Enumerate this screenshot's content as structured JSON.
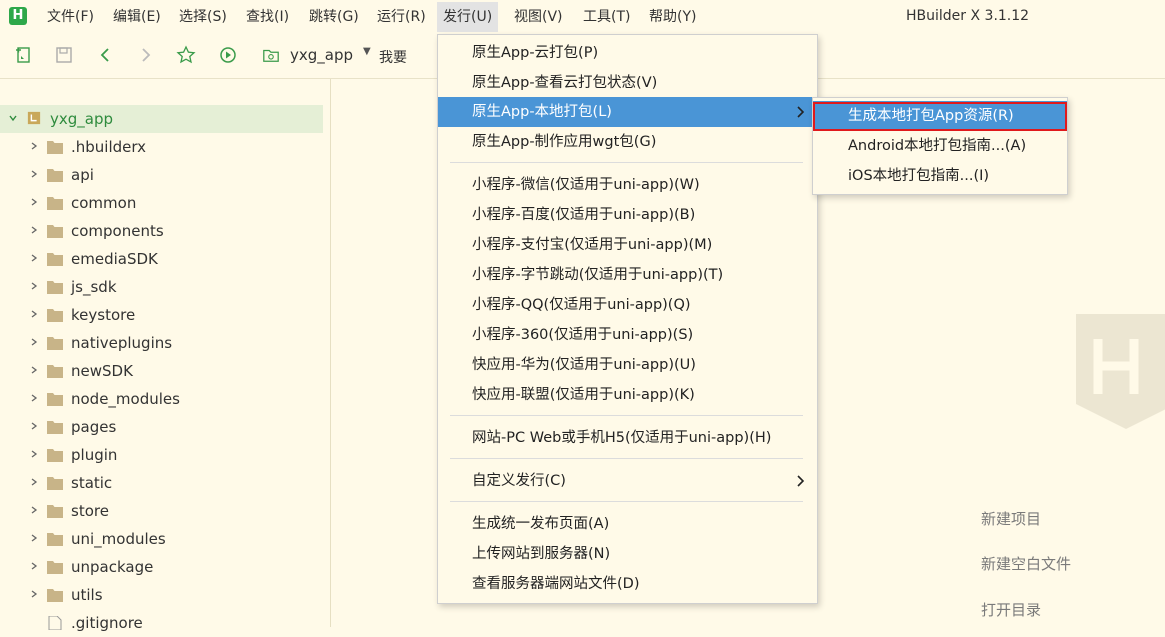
{
  "menubar": {
    "items": [
      "文件(F)",
      "编辑(E)",
      "选择(S)",
      "查找(I)",
      "跳转(G)",
      "运行(R)",
      "发行(U)",
      "视图(V)",
      "工具(T)",
      "帮助(Y)"
    ],
    "app_title": "HBuilder X 3.1.12",
    "logo": "H"
  },
  "toolbar": {
    "project_tab": "yxg_app",
    "search_text": "我要"
  },
  "sidebar": {
    "root": "yxg_app",
    "items": [
      ".hbuilderx",
      "api",
      "common",
      "components",
      "emediaSDK",
      "js_sdk",
      "keystore",
      "nativeplugins",
      "newSDK",
      "node_modules",
      "pages",
      "plugin",
      "static",
      "store",
      "uni_modules",
      "unpackage",
      "utils",
      ".gitignore"
    ]
  },
  "welcome": {
    "links": [
      "新建项目",
      "新建空白文件",
      "打开目录"
    ]
  },
  "publish_menu": {
    "items": [
      "原生App-云打包(P)",
      "原生App-查看云打包状态(V)",
      "原生App-本地打包(L)",
      "原生App-制作应用wgt包(G)",
      "小程序-微信(仅适用于uni-app)(W)",
      "小程序-百度(仅适用于uni-app)(B)",
      "小程序-支付宝(仅适用于uni-app)(M)",
      "小程序-字节跳动(仅适用于uni-app)(T)",
      "小程序-QQ(仅适用于uni-app)(Q)",
      "小程序-360(仅适用于uni-app)(S)",
      "快应用-华为(仅适用于uni-app)(U)",
      "快应用-联盟(仅适用于uni-app)(K)",
      "网站-PC Web或手机H5(仅适用于uni-app)(H)",
      "自定义发行(C)",
      "生成统一发布页面(A)",
      "上传网站到服务器(N)",
      "查看服务器端网站文件(D)"
    ]
  },
  "local_pack_submenu": {
    "items": [
      "生成本地打包App资源(R)",
      "Android本地打包指南...(A)",
      "iOS本地打包指南...(I)"
    ]
  },
  "colors": {
    "background": "#fffae8",
    "accent_green": "#2ea84a",
    "highlight_blue": "#4a95d6",
    "annotation_red": "#e0191c"
  }
}
